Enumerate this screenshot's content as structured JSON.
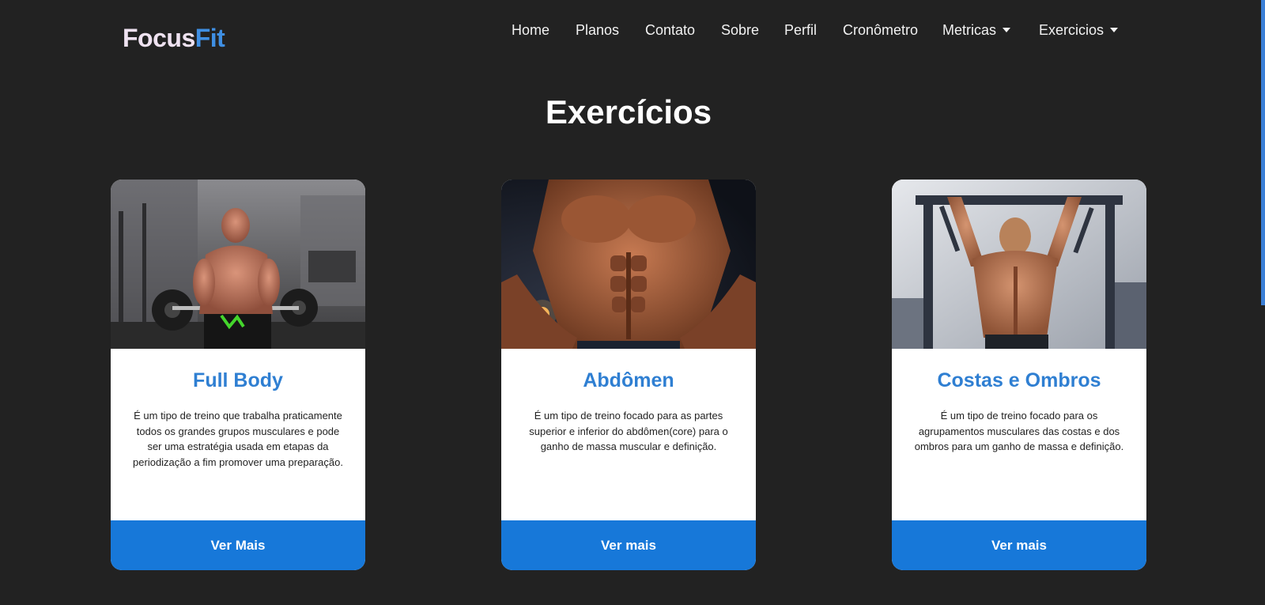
{
  "brand": {
    "part1": "Focus",
    "part2": "Fit"
  },
  "nav": {
    "items": [
      "Home",
      "Planos",
      "Contato",
      "Sobre",
      "Perfil",
      "Cronômetro"
    ],
    "dropdowns": [
      "Metricas",
      "Exercicios"
    ]
  },
  "page": {
    "title": "Exercícios"
  },
  "cards": [
    {
      "title": "Full Body",
      "description": "É um tipo de treino que trabalha praticamente todos os grandes grupos musculares e pode ser uma estratégia usada em etapas da periodização a fim promover uma preparação.",
      "button": "Ver Mais"
    },
    {
      "title": "Abdômen",
      "description": "É um tipo de treino focado para as partes superior e inferior do abdômen(core) para o ganho de massa muscular e definição.",
      "button": "Ver mais"
    },
    {
      "title": "Costas e Ombros",
      "description": "É um tipo de treino focado para os agrupamentos musculares das costas e dos ombros para um ganho de massa e definição.",
      "button": "Ver mais"
    }
  ],
  "colors": {
    "background": "#222222",
    "brand_light": "#efe2f1",
    "brand_accent": "#3f8fe3",
    "card_title": "#2f7fd2",
    "button": "#1778d9"
  }
}
